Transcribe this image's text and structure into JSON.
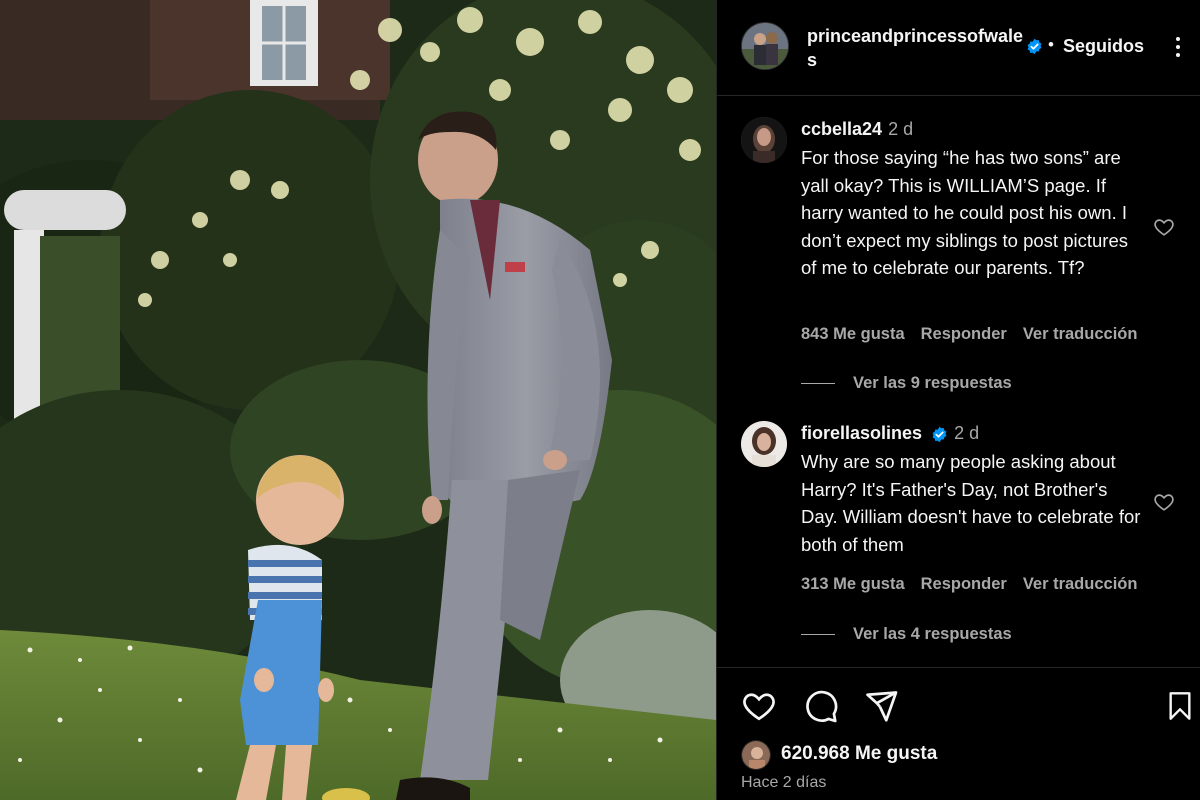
{
  "post": {
    "account": "princeandprincessofwales",
    "follow_label": "Seguidos",
    "follow_separator": "•",
    "likes_label": "620.968 Me gusta",
    "time_ago": "Hace 2 días"
  },
  "comments": [
    {
      "username": "ccbella24",
      "time": "2 d",
      "text": "For those saying “he has two sons” are yall okay? This is WILLIAM’S page. If harry wanted to he could post his own. I don’t expect my siblings to post pictures of me to celebrate our parents. Tf?",
      "likes": "843 Me gusta",
      "reply_label": "Responder",
      "translate_label": "Ver traducción",
      "replies_label": "Ver las 9 respuestas",
      "verified": false
    },
    {
      "username": "fiorellasolines",
      "time": "2 d",
      "text": "Why are so many people asking about Harry? It's Father's Day, not Brother's Day. William doesn't have to celebrate for both of them",
      "likes": "313 Me gusta",
      "reply_label": "Responder",
      "translate_label": "Ver traducción",
      "replies_label": "Ver las 4 respuestas",
      "verified": true
    }
  ],
  "icons": {
    "verified": "verified-badge-icon",
    "more": "more-options-icon",
    "like": "heart-icon",
    "comment": "comment-icon",
    "share": "share-icon",
    "save": "bookmark-icon"
  },
  "colors": {
    "background": "#000000",
    "text": "#f5f5f5",
    "muted": "#a8a8a8",
    "verified": "#0095f6",
    "divider": "#262626"
  }
}
